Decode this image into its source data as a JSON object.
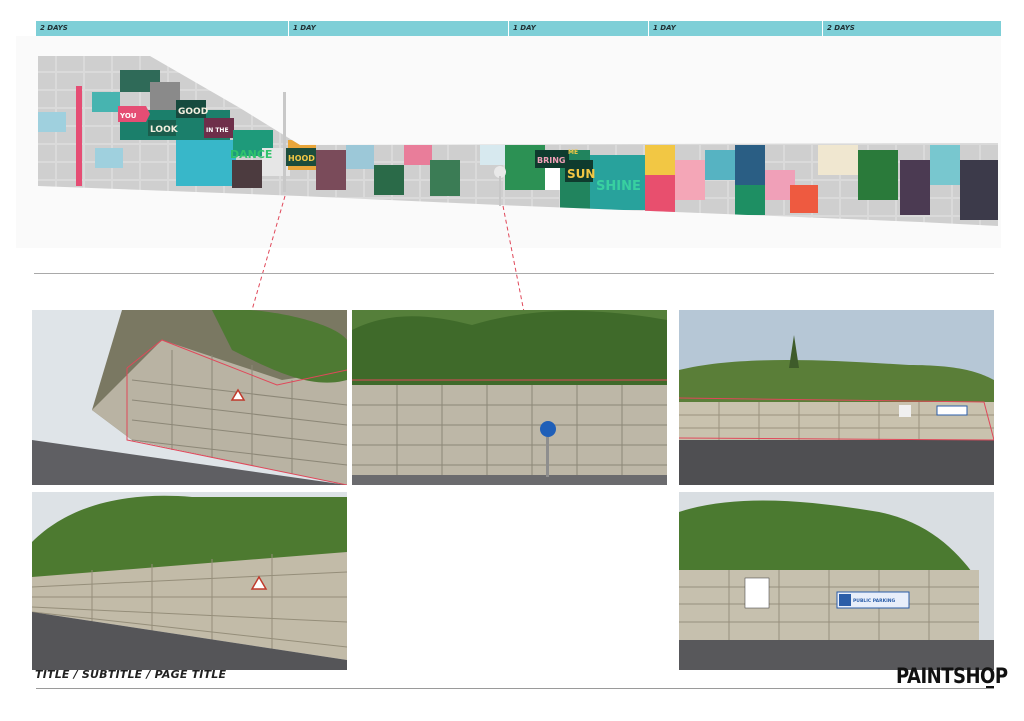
{
  "timeline": {
    "segments": [
      {
        "label": "2 DAYS"
      },
      {
        "label": "1 DAY"
      },
      {
        "label": "1 DAY"
      },
      {
        "label": "1 DAY"
      },
      {
        "label": "2 DAYS"
      }
    ]
  },
  "mural": {
    "words": [
      "YOU",
      "LOOK",
      "GOOD",
      "IN THE",
      "DANCE",
      "HOOD",
      "BRING",
      "ME",
      "SUN",
      "SHINE"
    ]
  },
  "photos": [
    {
      "name": "wall-photo-left-upper"
    },
    {
      "name": "wall-photo-center"
    },
    {
      "name": "wall-photo-right-upper"
    },
    {
      "name": "wall-photo-left-lower"
    },
    {
      "name": "wall-photo-right-lower"
    }
  ],
  "signs": {
    "parking": "PUBLIC PARKING"
  },
  "footer": {
    "title": "TITLE / SUBTITLE / PAGE TITLE",
    "logo": "PAINTSHOP"
  },
  "colors": {
    "timeline_bg": "#7ecfd7",
    "annotation_red": "#e0485a",
    "mural_pink": "#e54d74",
    "mural_teal": "#1a9a86"
  }
}
